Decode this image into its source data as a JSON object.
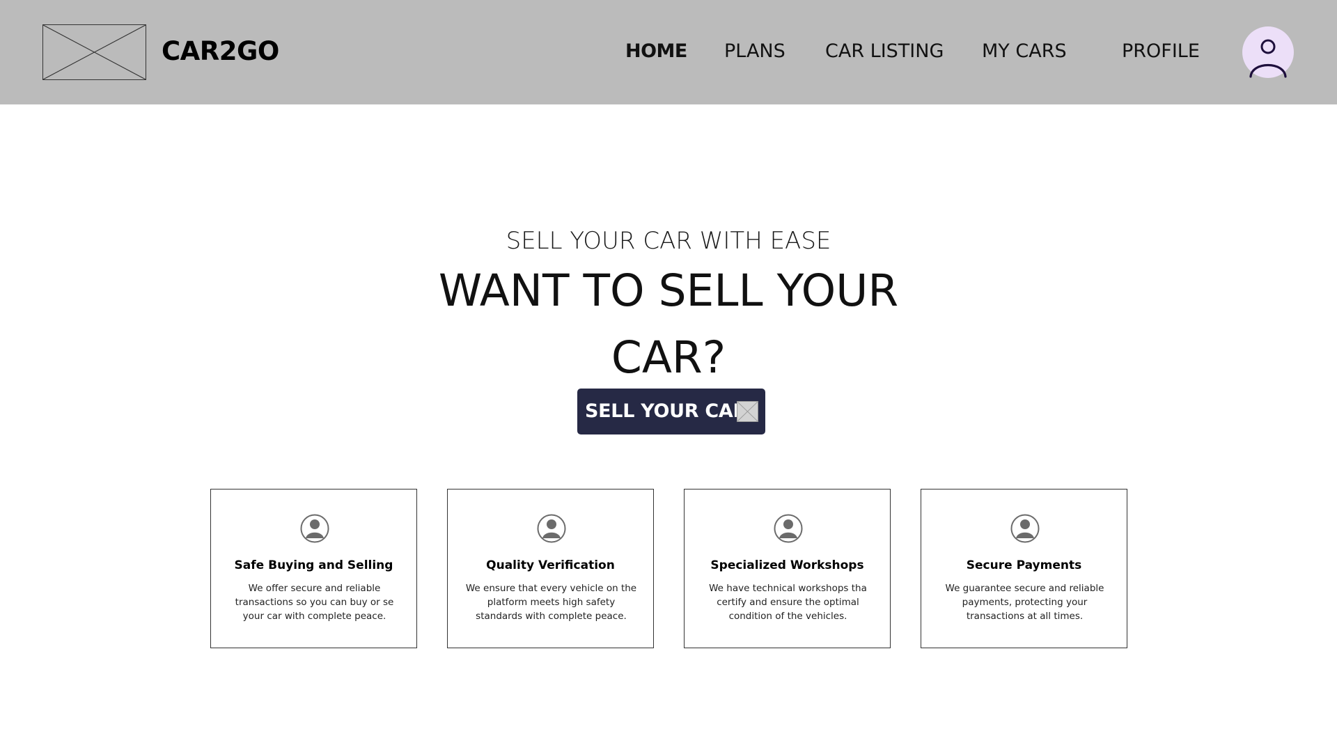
{
  "header": {
    "brand": "CAR2GO",
    "logo_icon": "image-placeholder-icon",
    "nav": [
      {
        "label": "HOME",
        "active": true
      },
      {
        "label": "PLANS",
        "active": false
      },
      {
        "label": "CAR LISTING",
        "active": false
      },
      {
        "label": "MY CARS",
        "active": false
      },
      {
        "label": "PROFILE",
        "active": false
      }
    ],
    "avatar_icon": "user-icon"
  },
  "hero": {
    "kicker": "SELL YOUR CAR WITH EASE",
    "title_line1": "WANT TO SELL YOUR",
    "title_line2": "CAR?",
    "cta_label": "SELL YOUR CAR",
    "cta_icon": "image-placeholder-icon"
  },
  "features": [
    {
      "icon": "person-icon",
      "title": "Safe Buying and Selling",
      "text": "We offer secure and reliable transactions so you can buy or se your car with complete peace."
    },
    {
      "icon": "person-icon",
      "title": "Quality Verification",
      "text": "We ensure that every vehicle on the platform meets high safety standards with complete peace."
    },
    {
      "icon": "person-icon",
      "title": "Specialized Workshops",
      "text": "We have technical workshops tha certify and ensure the optimal condition of the vehicles."
    },
    {
      "icon": "person-icon",
      "title": "Secure Payments",
      "text": "We guarantee secure and reliable payments, protecting your transactions at all times."
    }
  ],
  "colors": {
    "header_bg": "#bbbbbb",
    "cta_bg": "#262945",
    "avatar_bg": "#ecdff8",
    "avatar_stroke": "#1e0f3c",
    "card_icon": "#6b6b6b"
  }
}
